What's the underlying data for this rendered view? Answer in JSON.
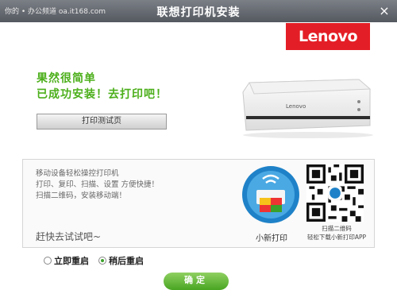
{
  "window": {
    "watermark": "你的 • 办公频道 oa.it168.com",
    "title": "联想打印机安装",
    "close_label": "×"
  },
  "brand": {
    "logo_text": "Lenovo",
    "color": "#e41e26"
  },
  "printer": {
    "label": "Lenovo"
  },
  "status": {
    "line1": "果然很简单",
    "line2": "已成功安装！去打印吧！",
    "color": "#4caf1b"
  },
  "test_page_button": {
    "label": "打印测试页"
  },
  "promo": {
    "lines": [
      "移动设备轻松操控打印机",
      "打印、复印、扫描、设置 方便快捷！",
      "扫描二维码，安装移动端！"
    ],
    "cta": "赶快去试试吧~",
    "app_name": "小新打印",
    "qr_caption_1": "扫描二维码",
    "qr_caption_2": "轻松下载小新打印APP"
  },
  "restart": {
    "options": [
      {
        "label": "立即重启",
        "selected": false
      },
      {
        "label": "稍后重启",
        "selected": true
      }
    ]
  },
  "confirm_button": {
    "label": "确定"
  }
}
